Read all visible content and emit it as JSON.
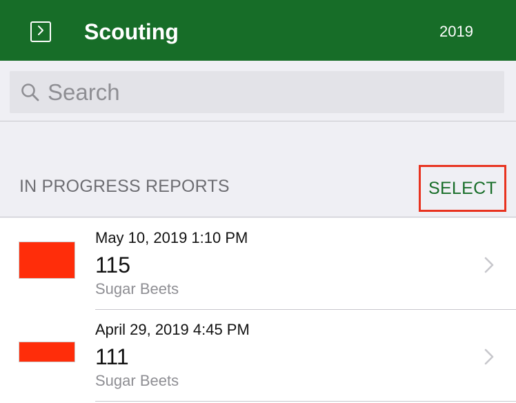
{
  "header": {
    "title": "Scouting",
    "year": "2019",
    "sidebar_icon": "sidebar-toggle-icon"
  },
  "search": {
    "placeholder": "Search",
    "value": "",
    "icon": "search-icon"
  },
  "section": {
    "title": "IN PROGRESS REPORTS",
    "select_label": "SELECT"
  },
  "reports": [
    {
      "datetime": "May 10, 2019 1:10 PM",
      "number": "115",
      "crop": "Sugar Beets",
      "color": "#ff2d0a"
    },
    {
      "datetime": "April 29, 2019 4:45 PM",
      "number": "111",
      "crop": "Sugar Beets",
      "color": "#ff2d0a"
    }
  ],
  "colors": {
    "brand_green": "#176d28",
    "highlight_red": "#e8321f"
  }
}
